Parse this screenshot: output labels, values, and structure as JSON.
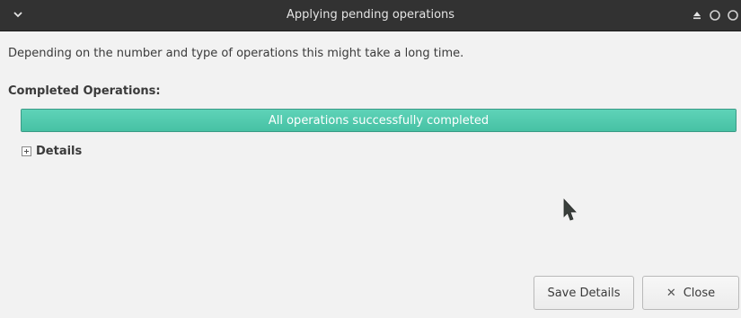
{
  "window": {
    "title": "Applying pending operations"
  },
  "titlebar": {
    "menu_icon": "chevron-down-icon",
    "buttons": [
      "eject-icon",
      "minimize-icon",
      "close-circle-icon"
    ]
  },
  "main": {
    "description": "Depending on the number and type of operations this might take a long time.",
    "section_label": "Completed Operations:",
    "progress": {
      "text": "All operations successfully completed",
      "fraction": 1.0,
      "color": "#4ec8ab"
    },
    "details": {
      "label": "Details",
      "expanded": false,
      "icon": "expander-plus-icon"
    }
  },
  "buttons": {
    "save_details": "Save Details",
    "close": "Close",
    "close_glyph": "✕"
  },
  "colors": {
    "titlebar": "#323232",
    "accent": "#4ec8ab",
    "background": "#f2f2f2"
  }
}
